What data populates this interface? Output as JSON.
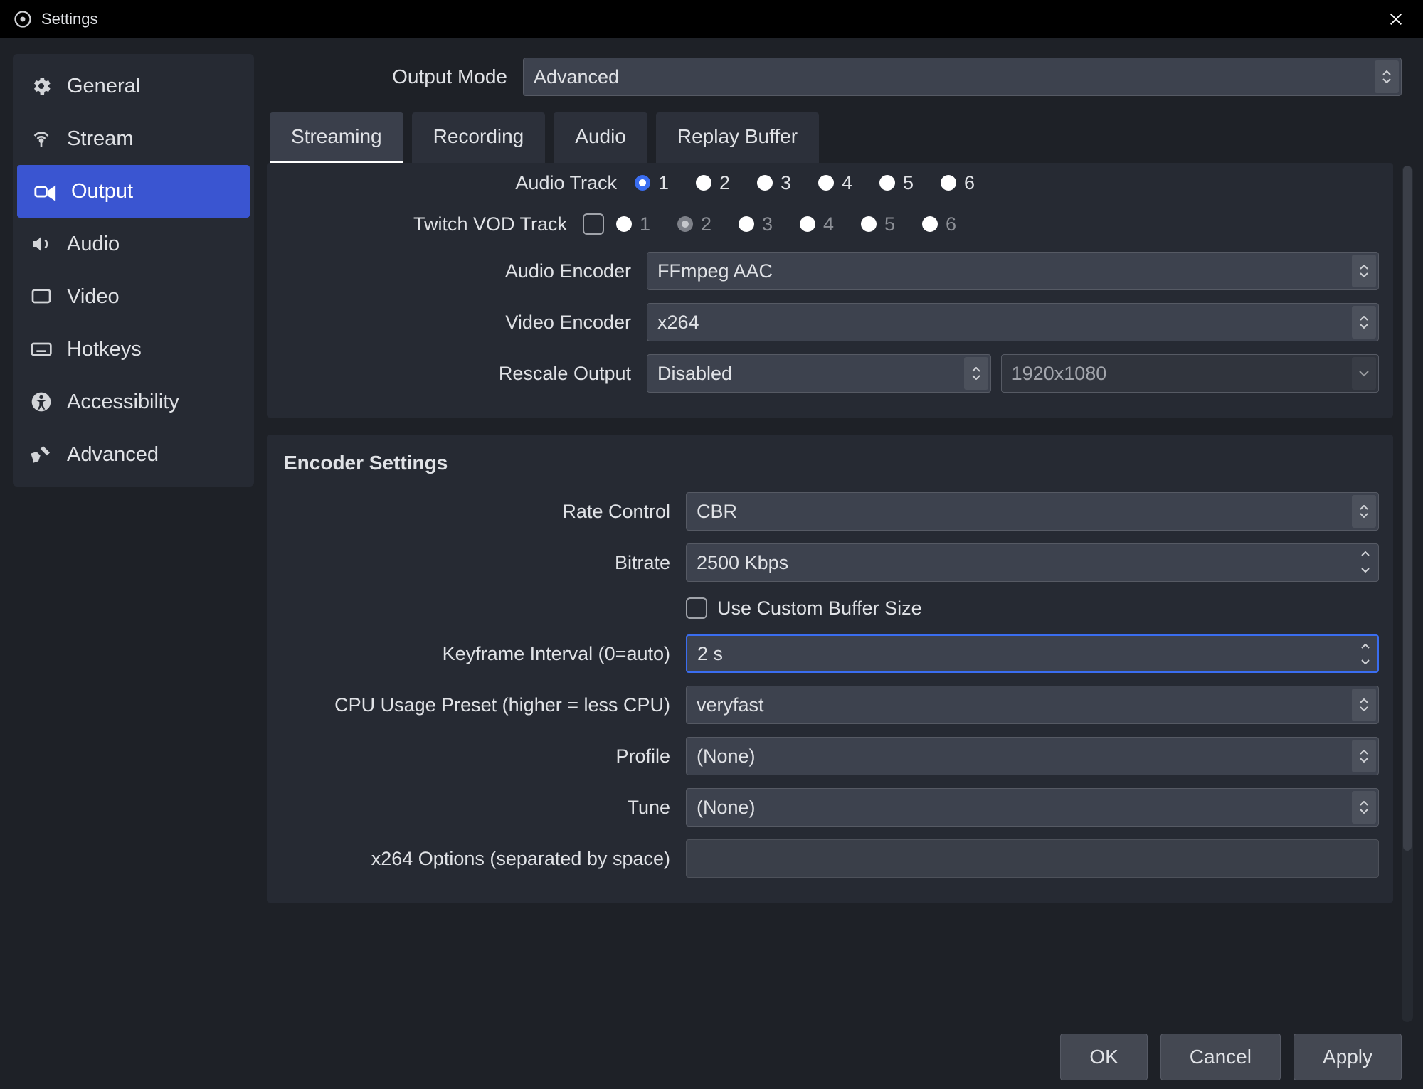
{
  "window": {
    "title": "Settings"
  },
  "sidebar": {
    "items": [
      {
        "label": "General"
      },
      {
        "label": "Stream"
      },
      {
        "label": "Output"
      },
      {
        "label": "Audio"
      },
      {
        "label": "Video"
      },
      {
        "label": "Hotkeys"
      },
      {
        "label": "Accessibility"
      },
      {
        "label": "Advanced"
      }
    ]
  },
  "output_mode": {
    "label": "Output Mode",
    "value": "Advanced"
  },
  "tabs": [
    {
      "label": "Streaming"
    },
    {
      "label": "Recording"
    },
    {
      "label": "Audio"
    },
    {
      "label": "Replay Buffer"
    }
  ],
  "streaming": {
    "audio_track": {
      "label": "Audio Track",
      "options": [
        "1",
        "2",
        "3",
        "4",
        "5",
        "6"
      ],
      "selected": 0
    },
    "twitch_vod": {
      "label": "Twitch VOD Track",
      "checked": false,
      "options": [
        "1",
        "2",
        "3",
        "4",
        "5",
        "6"
      ],
      "selected": 1,
      "disabled_index": 1
    },
    "audio_encoder": {
      "label": "Audio Encoder",
      "value": "FFmpeg AAC"
    },
    "video_encoder": {
      "label": "Video Encoder",
      "value": "x264"
    },
    "rescale_output": {
      "label": "Rescale Output",
      "value": "Disabled",
      "resolution": "1920x1080"
    }
  },
  "encoder": {
    "title": "Encoder Settings",
    "rate_control": {
      "label": "Rate Control",
      "value": "CBR"
    },
    "bitrate": {
      "label": "Bitrate",
      "value": "2500 Kbps"
    },
    "custom_buffer": {
      "label": "Use Custom Buffer Size",
      "checked": false
    },
    "keyframe": {
      "label": "Keyframe Interval (0=auto)",
      "value": "2 s"
    },
    "cpu_preset": {
      "label": "CPU Usage Preset (higher = less CPU)",
      "value": "veryfast"
    },
    "profile": {
      "label": "Profile",
      "value": "(None)"
    },
    "tune": {
      "label": "Tune",
      "value": "(None)"
    },
    "x264_opts": {
      "label": "x264 Options (separated by space)",
      "value": ""
    }
  },
  "footer": {
    "ok": "OK",
    "cancel": "Cancel",
    "apply": "Apply"
  }
}
